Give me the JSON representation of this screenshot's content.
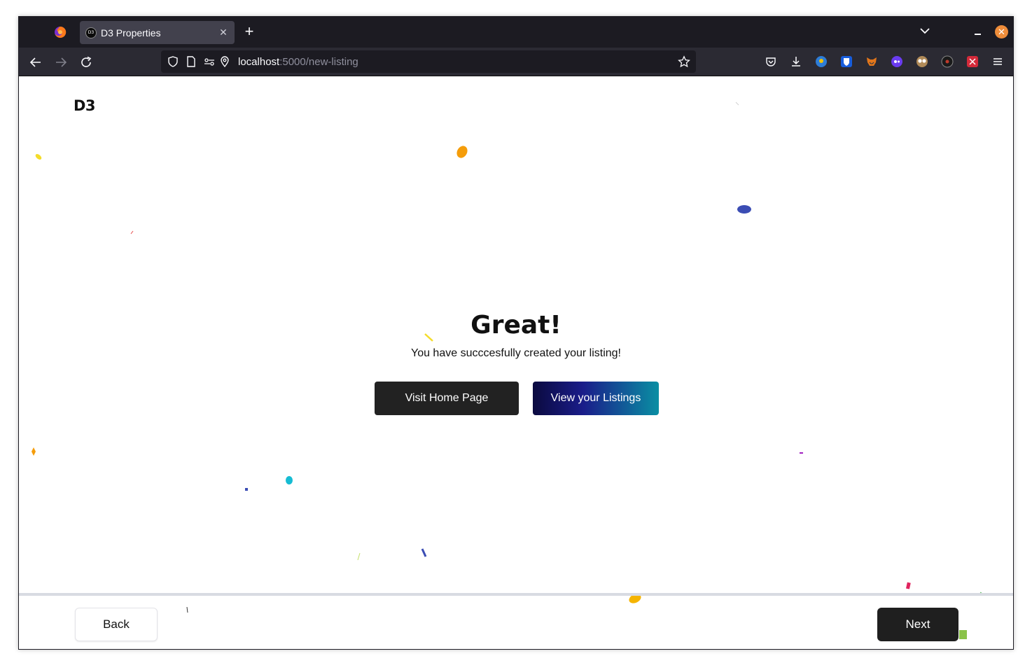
{
  "browser": {
    "tab_title": "D3 Properties",
    "tab_favicon_text": "D3",
    "url_host": "localhost",
    "url_path": ":5000/new-listing",
    "accent_close_color": "#ef8d3a"
  },
  "page": {
    "brand": "D3",
    "headline": "Great!",
    "message": "You have succcesfully created your listing!",
    "buttons": {
      "visit_home": "Visit Home Page",
      "view_listings": "View your Listings"
    },
    "footer": {
      "back": "Back",
      "next": "Next"
    }
  },
  "icons": [
    "firefox-icon",
    "back-arrow-icon",
    "forward-arrow-icon",
    "reload-icon",
    "shield-icon",
    "page-icon",
    "permissions-icon",
    "location-icon",
    "bookmark-star-icon",
    "pocket-icon",
    "download-icon",
    "extension-icons",
    "menu-icon"
  ]
}
